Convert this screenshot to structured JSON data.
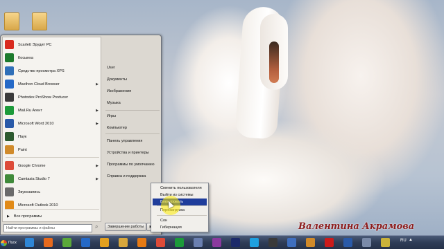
{
  "start_menu": {
    "programs": [
      {
        "label": "Scarlett Эрудит PC",
        "icon": "scarlett-icon",
        "color": "#d92b1f",
        "has_submenu": false
      },
      {
        "label": "Косынка",
        "icon": "solitaire-icon",
        "color": "#1c7a2c",
        "has_submenu": false
      },
      {
        "label": "Средство просмотра XPS",
        "icon": "xps-viewer-icon",
        "color": "#2f6fb8",
        "has_submenu": false
      },
      {
        "label": "Maxthon Cloud Browser",
        "icon": "maxthon-icon",
        "color": "#2569c7",
        "has_submenu": true
      },
      {
        "label": "Photodex ProShow Producer",
        "icon": "proshow-icon",
        "color": "#3a3a3a",
        "has_submenu": false
      },
      {
        "label": "Mail.Ru Агент",
        "icon": "mailru-agent-icon",
        "color": "#1c9a3a",
        "has_submenu": true
      },
      {
        "label": "Microsoft Word 2010",
        "icon": "word-icon",
        "color": "#2a5aa8",
        "has_submenu": true
      },
      {
        "label": "Паук",
        "icon": "spider-solitaire-icon",
        "color": "#2d5a2f",
        "has_submenu": false
      },
      {
        "label": "Paint",
        "icon": "paint-icon",
        "color": "#d08a2a",
        "has_submenu": false
      },
      {
        "label": "Google Chrome",
        "icon": "chrome-icon",
        "color": "#dd4b39",
        "has_submenu": true
      },
      {
        "label": "Camtasia Studio 7",
        "icon": "camtasia-icon",
        "color": "#3f8a3a",
        "has_submenu": true
      },
      {
        "label": "Звукозапись",
        "icon": "sound-recorder-icon",
        "color": "#6a6a6a",
        "has_submenu": false
      },
      {
        "label": "Microsoft Outlook 2010",
        "icon": "outlook-icon",
        "color": "#e18a17",
        "has_submenu": false
      }
    ],
    "all_programs": "Все программы",
    "search_placeholder": "Найти программы и файлы",
    "right_items": [
      "User",
      "Документы",
      "Изображения",
      "Музыка",
      "Игры",
      "Компьютер",
      "Панель управления",
      "Устройства и принтеры",
      "Программы по умолчанию",
      "Справка и поддержка"
    ],
    "shutdown_label": "Завершение работы"
  },
  "shutdown_submenu": {
    "items": [
      "Сменить пользователя",
      "Выйти из системы",
      "Блокировать",
      "Перезагрузка",
      "Сон",
      "Гибернация"
    ],
    "selected": "Блокировать"
  },
  "taskbar": {
    "start_label": "Пуск",
    "pinned_icons": [
      {
        "name": "ie-icon",
        "color": "#2f86d6"
      },
      {
        "name": "firefox-icon",
        "color": "#e66a1e"
      },
      {
        "name": "utorrent-icon",
        "color": "#5aa83a"
      },
      {
        "name": "maxthon-icon",
        "color": "#2569c7"
      },
      {
        "name": "video-player-icon",
        "color": "#e2a020"
      },
      {
        "name": "folder-icon",
        "color": "#d7a73d"
      },
      {
        "name": "media-player-icon",
        "color": "#e67a14"
      },
      {
        "name": "chrome-icon",
        "color": "#dd4b39"
      },
      {
        "name": "mailru-agent-icon",
        "color": "#1c9a3a"
      },
      {
        "name": "calendar-icon",
        "color": "#6a7fb0"
      },
      {
        "name": "onenote-icon",
        "color": "#8a3a9e"
      },
      {
        "name": "photoshop-icon",
        "color": "#1b2a6a"
      },
      {
        "name": "skype-icon",
        "color": "#1ea0e0"
      },
      {
        "name": "photodex-icon",
        "color": "#3a3a3a"
      },
      {
        "name": "mail-icon",
        "color": "#3f6fbf"
      },
      {
        "name": "paint-icon",
        "color": "#d08a2a"
      },
      {
        "name": "opera-icon",
        "color": "#cc1b1b"
      },
      {
        "name": "word-icon",
        "color": "#2a5aa8"
      },
      {
        "name": "network-icon",
        "color": "#7a8aa8"
      },
      {
        "name": "notes-icon",
        "color": "#c9b23a"
      }
    ],
    "language": "RU"
  },
  "watermark": "Валентина Акрамова"
}
